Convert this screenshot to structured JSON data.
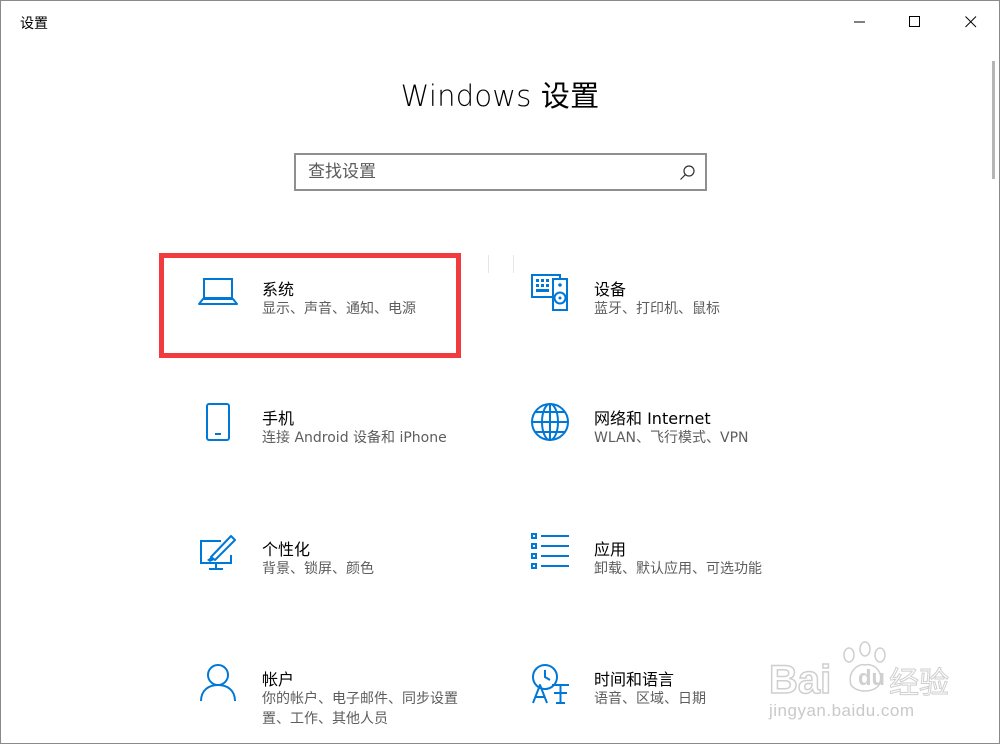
{
  "window": {
    "title": "设置"
  },
  "header": {
    "title": "Windows 设置"
  },
  "search": {
    "placeholder": "查找设置"
  },
  "accent_color": "#0078d7",
  "highlight_color": "#f23b3f",
  "categories": [
    {
      "name": "系统",
      "desc": "显示、声音、通知、电源",
      "icon": "laptop-icon"
    },
    {
      "name": "设备",
      "desc": "蓝牙、打印机、鼠标",
      "icon": "devices-icon"
    },
    {
      "name": "手机",
      "desc": "连接 Android 设备和 iPhone",
      "icon": "phone-icon"
    },
    {
      "name": "网络和 Internet",
      "desc": "WLAN、飞行模式、VPN",
      "icon": "globe-icon"
    },
    {
      "name": "个性化",
      "desc": "背景、锁屏、颜色",
      "icon": "personalization-icon"
    },
    {
      "name": "应用",
      "desc": "卸载、默认应用、可选功能",
      "icon": "apps-list-icon"
    },
    {
      "name": "帐户",
      "desc": "你的帐户、电子邮件、同步设置、工作、其他人员",
      "desc_lines": [
        "你的帐户、电子邮件、同步设置",
        "置、工作、其他人员"
      ],
      "icon": "account-icon"
    },
    {
      "name": "时间和语言",
      "desc": "语音、区域、日期",
      "icon": "time-language-icon"
    }
  ],
  "watermark": {
    "logo_text": "Baidu经验",
    "url": "jingyan.baidu.com"
  }
}
